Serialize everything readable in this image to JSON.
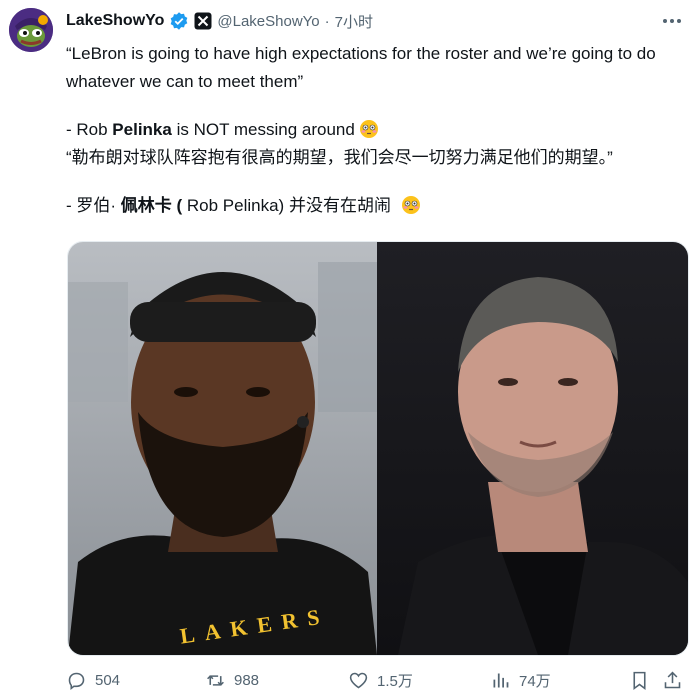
{
  "tweet": {
    "author_name": "LakeShowYo",
    "verified_badge": "verified-check-icon",
    "account_badge": "x-affiliate-icon",
    "handle": "@LakeShowYo",
    "separator": "·",
    "time": "7小时",
    "lines": {
      "quote_en": "“LeBron is going to have high expectations for the roster and we’re going to do whatever we can to meet them”",
      "en_attrib_prefix": "- Rob ",
      "en_attrib_bold": "Pelinka",
      "en_attrib_suffix": " is NOT messing around",
      "quote_zh": "“勒布朗对球队阵容抱有很高的期望，我们会尽一切努力满足他们的期望。”",
      "zh_attrib_prefix": "- 罗伯· ",
      "zh_attrib_bold": "佩林卡 (",
      "zh_attrib_suffix": " Rob Pelinka) 并没有在胡闹"
    },
    "media_lettering": "LAKERS"
  },
  "actions": {
    "replies": "504",
    "retweets": "988",
    "likes": "1.5万",
    "views": "74万"
  }
}
